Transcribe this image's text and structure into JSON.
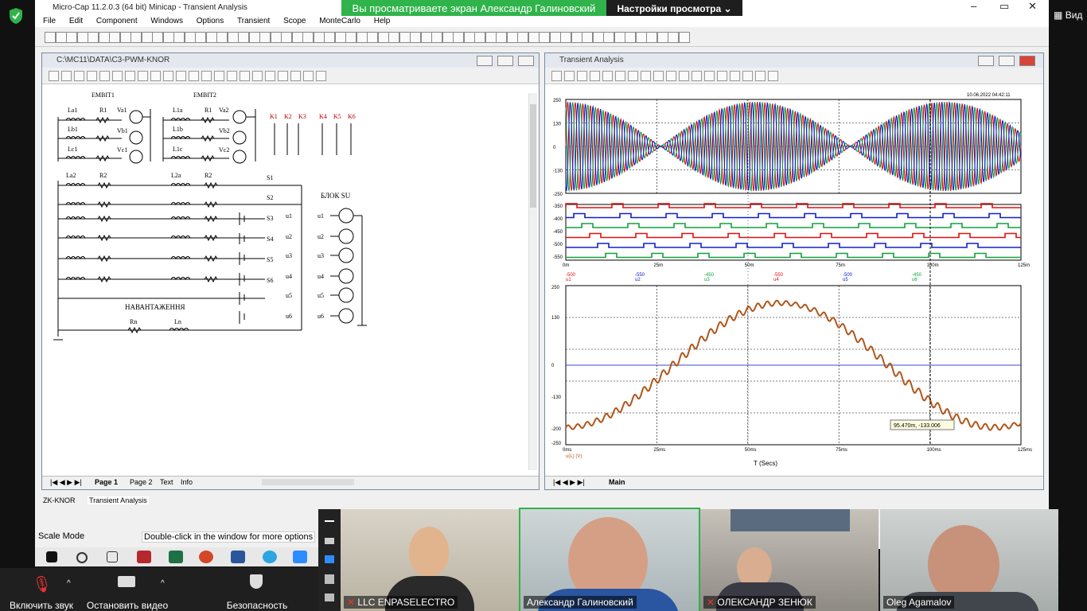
{
  "meeting": {
    "banner_text": "Вы просматриваете экран Александр Галиновский",
    "view_settings": "Настройки просмотра",
    "view_label": "Вид"
  },
  "app": {
    "title": "Micro-Cap 11.2.0.3 (64 bit) Minicap - Transient Analysis",
    "menu": [
      "File",
      "Edit",
      "Component",
      "Windows",
      "Options",
      "Transient",
      "Scope",
      "MonteCarlo",
      "Help"
    ],
    "window_controls": [
      "–",
      "▭",
      "✕"
    ]
  },
  "schematic": {
    "title": "C:\\MC11\\DATA\\C3-PWM-KNOR",
    "labels": {
      "emb1": "ЕМВІТ1",
      "emb2": "ЕМВІТ2",
      "la1": "La1",
      "lb1": "Lb1",
      "lc1": "Lc1",
      "l1a": "L1a",
      "l1b": "L1b",
      "l1c": "L1c",
      "r1": "R1",
      "r1b": "R1",
      "va1": "Va1",
      "vb1": "Vb1",
      "vc1": "Vc1",
      "va2": "Va2",
      "vb2": "Vb2",
      "vc2": "Vc2",
      "k": [
        "K1",
        "K2",
        "K3",
        "K4",
        "K5",
        "K6"
      ],
      "la2": "La2",
      "l2a": "L2a",
      "r2": "R2",
      "r2b": "R2",
      "s1": "S1",
      "s2": "S2",
      "s3": "S3",
      "s4": "S4",
      "s5": "S5",
      "s6": "S6",
      "u": [
        "u1",
        "u2",
        "u3",
        "u4",
        "u5",
        "u6"
      ],
      "blok": "БЛОК SU",
      "nav": "НАВАНТАЖЕННЯ",
      "rn": "Rn",
      "ln": "Ln"
    },
    "tabs": [
      "Page 1",
      "Page 2",
      "Text",
      "Info"
    ]
  },
  "analysis": {
    "title": "Transient Analysis",
    "date": "10.06.2022 04:42:11",
    "tab": "Main",
    "top_y_ticks": [
      "250",
      "130",
      "0",
      "-130",
      "-250"
    ],
    "mid_y_ticks": [
      "-350",
      "-400",
      "-450",
      "-500",
      "-550"
    ],
    "x_ticks": [
      "0m",
      "25m",
      "50m",
      "75m",
      "100m",
      "125m"
    ],
    "mid_legend": [
      "u1",
      "u2",
      "u3",
      "u4",
      "u5",
      "u6"
    ],
    "mid_vals": [
      "-500",
      "-550",
      "-450",
      "-550",
      "-500",
      "-450"
    ],
    "bottom_y_ticks": [
      "250",
      "130",
      "0",
      "-130",
      "-200",
      "-250"
    ],
    "bottom_x_ticks": [
      "0ms",
      "25ms",
      "50ms",
      "75ms",
      "100ms",
      "125ms"
    ],
    "bottom_xlabel": "T (Secs)",
    "bottom_trace_label": "u(L) (V)",
    "cursor_tip": "95.470m, -133.006"
  },
  "doc_tabs": [
    "ZK-KNOR",
    "Transient Analysis"
  ],
  "status": {
    "mode": "Scale Mode",
    "hint": "Double-click in the window for more options"
  },
  "zoom_controls": {
    "unmute": "Включить звук",
    "stop_video": "Остановить видео",
    "security": "Безопасность"
  },
  "participants": [
    "LLC ENPASELECTRO",
    "Александр Галиновский",
    "ОЛЕКСАНДР ЗЕНЮК",
    "Oleg Agamalov"
  ],
  "colors": {
    "red": "#e01010",
    "green": "#12a040",
    "blue": "#1020c8",
    "brown": "#b0561a",
    "zoom_green": "#2fb34a"
  }
}
